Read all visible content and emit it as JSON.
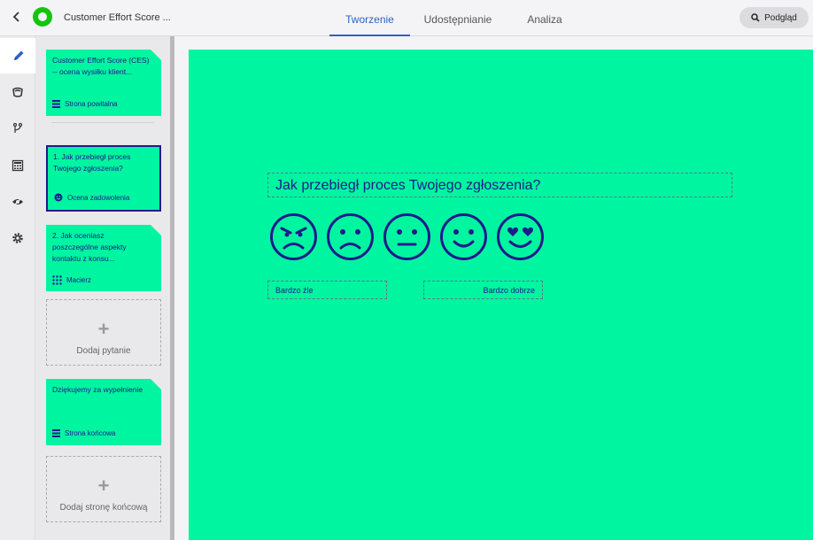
{
  "header": {
    "survey_title": "Customer Effort Score ...",
    "tabs": [
      "Tworzenie",
      "Udostępnianie",
      "Analiza"
    ],
    "preview_label": "Podgląd",
    "accent_color": "#2b63c6",
    "logo_color": "#14c40e"
  },
  "rail": {
    "icons": [
      "pencil-icon",
      "theme-icon",
      "logic-branch-icon",
      "calculator-icon",
      "visibility-icon",
      "settings-gear-icon"
    ]
  },
  "cards": {
    "welcome": {
      "text": "Customer Effort Score (CES) -- ocena wysiłku klient...",
      "type": "Strona powitalna"
    },
    "q1": {
      "text": "1. Jak przebiegł proces Twojego zgłoszenia?",
      "type": "Ocena zadowolenia"
    },
    "q2": {
      "text": "2. Jak oceniasz poszczególne aspekty kontaktu z konsu...",
      "type": "Macierz"
    },
    "add_question": "Dodaj pytanie",
    "thanks": {
      "text": "Dziękujemy za wypełnienie",
      "type": "Strona końcowa"
    },
    "add_end_page": "Dodaj stronę końcową"
  },
  "canvas": {
    "background": "#00f5a0",
    "text_color": "#1f1a8c",
    "question": "Jak przebiegł proces Twojego zgłoszenia?",
    "faces": [
      "angry-face-icon",
      "sad-face-icon",
      "neutral-face-icon",
      "smile-face-icon",
      "heart-eyes-face-icon"
    ],
    "label_low": "Bardzo źle",
    "label_high": "Bardzo dobrze"
  }
}
